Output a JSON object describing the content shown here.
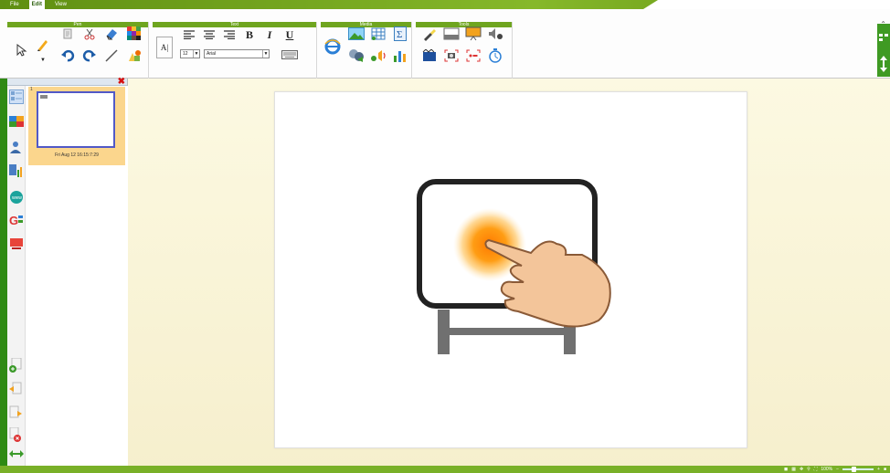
{
  "menu": {
    "file": "File",
    "edit": "Edit",
    "view": "View"
  },
  "ribbon": {
    "groups": [
      "Pen",
      "Text",
      "Media",
      "Tools"
    ],
    "font_size": "12",
    "font_name": "Arial",
    "text_buttons": {
      "bold": "B",
      "italic": "I",
      "underline": "U",
      "text_box": "A|"
    }
  },
  "panel": {
    "page_number": "1",
    "page_date": "Fri Aug 12 16:15:7:29"
  },
  "status": {
    "zoom": "100%",
    "zoom_level": 0.35
  },
  "colors": {
    "accent": "#6fa51f",
    "dark_green": "#2f8a14",
    "selection": "#fbd68d"
  }
}
